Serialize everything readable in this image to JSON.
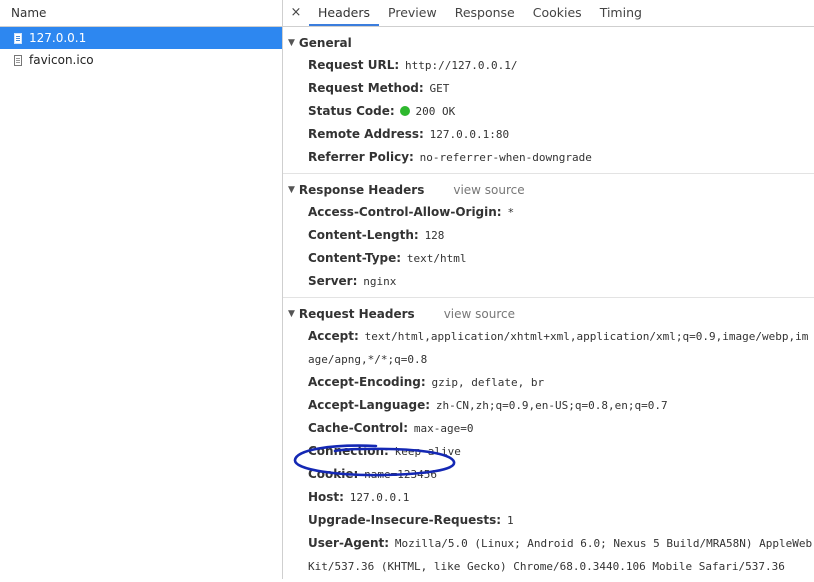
{
  "left_panel": {
    "header": "Name",
    "files": [
      {
        "name": "127.0.0.1",
        "selected": true
      },
      {
        "name": "favicon.ico",
        "selected": false
      }
    ]
  },
  "tabs": {
    "close": "×",
    "items": [
      "Headers",
      "Preview",
      "Response",
      "Cookies",
      "Timing"
    ],
    "active": "Headers"
  },
  "general": {
    "title": "General",
    "rows": [
      {
        "key": "Request URL:",
        "value": "http://127.0.0.1/"
      },
      {
        "key": "Request Method:",
        "value": "GET"
      },
      {
        "key": "Status Code:",
        "value": "200 OK"
      },
      {
        "key": "Remote Address:",
        "value": "127.0.0.1:80"
      },
      {
        "key": "Referrer Policy:",
        "value": "no-referrer-when-downgrade"
      }
    ]
  },
  "response_headers": {
    "title": "Response Headers",
    "view_source": "view source",
    "rows": [
      {
        "key": "Access-Control-Allow-Origin:",
        "value": "*"
      },
      {
        "key": "Content-Length:",
        "value": "128"
      },
      {
        "key": "Content-Type:",
        "value": "text/html"
      },
      {
        "key": "Server:",
        "value": "nginx"
      }
    ]
  },
  "request_headers": {
    "title": "Request Headers",
    "view_source": "view source",
    "rows": [
      {
        "key": "Accept:",
        "value": "text/html,application/xhtml+xml,application/xml;q=0.9,image/webp,image/apng,*/*;q=0.8"
      },
      {
        "key": "Accept-Encoding:",
        "value": "gzip, deflate, br"
      },
      {
        "key": "Accept-Language:",
        "value": "zh-CN,zh;q=0.9,en-US;q=0.8,en;q=0.7"
      },
      {
        "key": "Cache-Control:",
        "value": "max-age=0"
      },
      {
        "key": "Connection:",
        "value": "keep-alive"
      },
      {
        "key": "Cookie:",
        "value": "name=123456"
      },
      {
        "key": "Host:",
        "value": "127.0.0.1"
      },
      {
        "key": "Upgrade-Insecure-Requests:",
        "value": "1"
      },
      {
        "key": "User-Agent:",
        "value": "Mozilla/5.0 (Linux; Android 6.0; Nexus 5 Build/MRA58N) AppleWebKit/537.36 (KHTML, like Gecko) Chrome/68.0.3440.106 Mobile Safari/537.36"
      }
    ]
  },
  "colors": {
    "selected_row": "#2d87f0",
    "active_tab_underline": "#3b7ddd",
    "status_ok": "#2eb82e",
    "annotation": "#1428b4"
  }
}
